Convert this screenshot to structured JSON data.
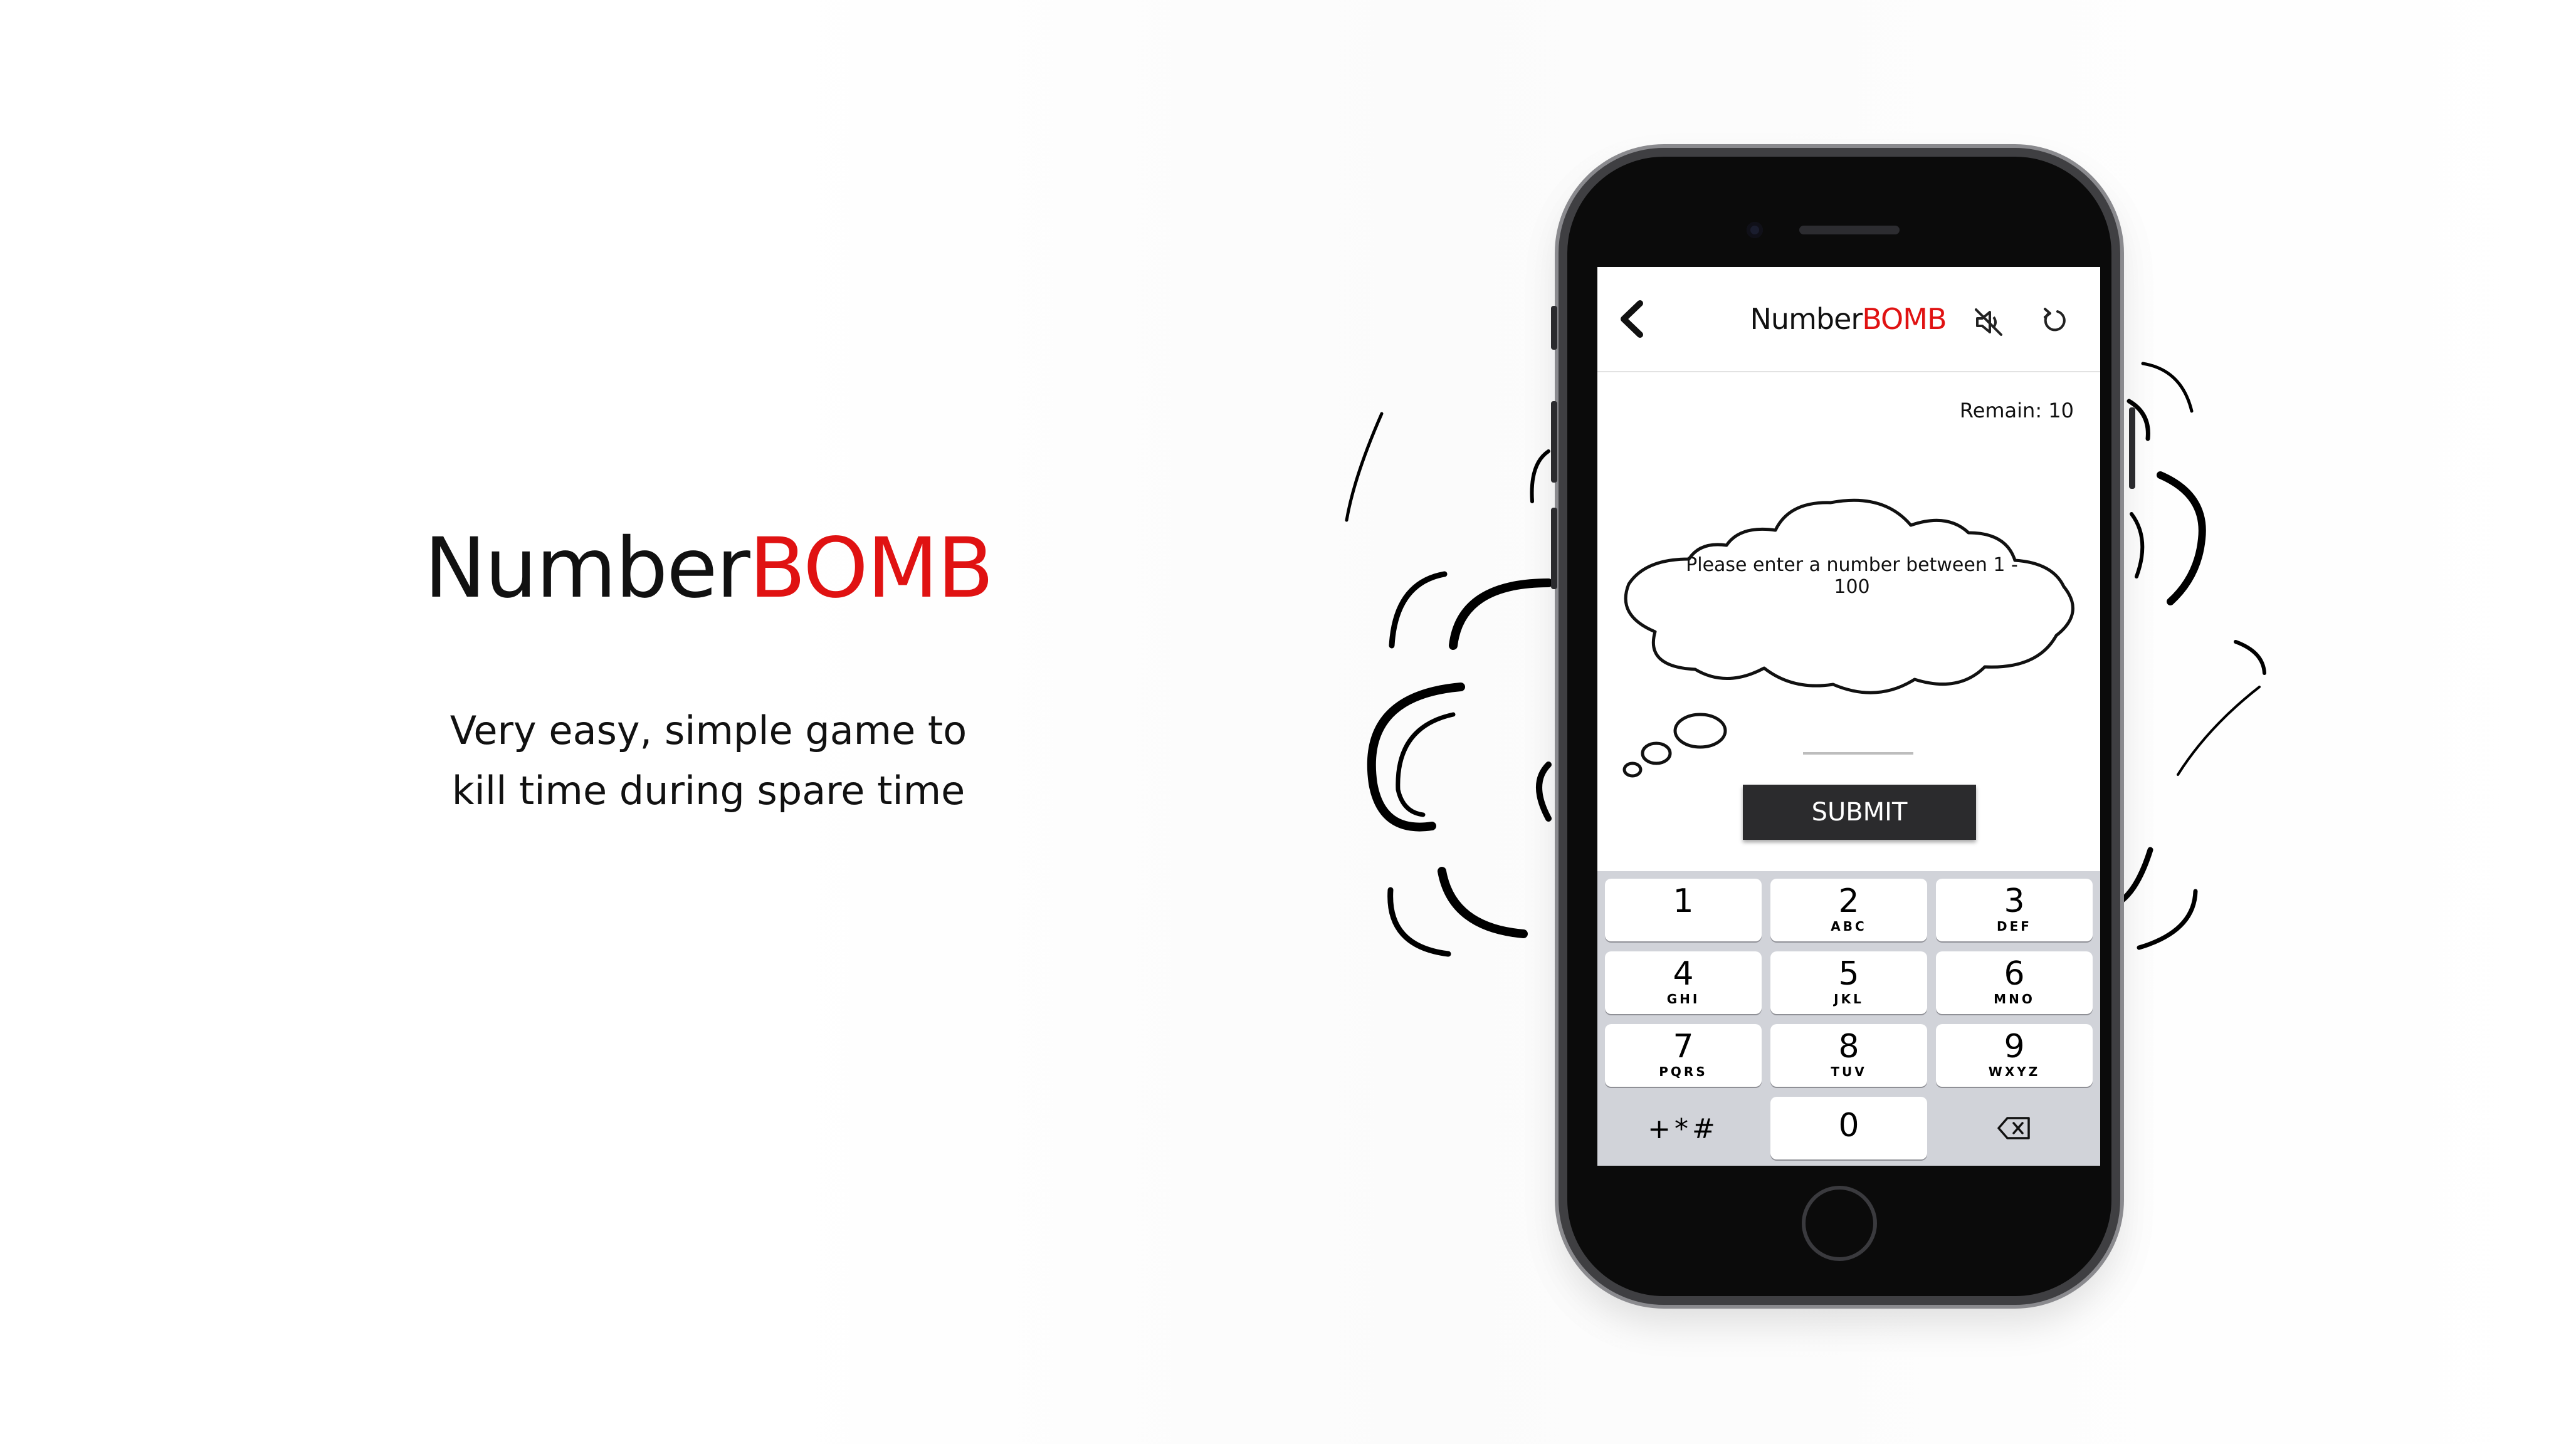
{
  "promo": {
    "title_part1": "Number",
    "title_part2": "BOMB",
    "description": [
      "Very easy, simple game to",
      "kill time during spare time"
    ]
  },
  "nav": {
    "back_icon": "chevron-left-icon",
    "title_part1": "Number",
    "title_part2": "BOMB",
    "mute_icon": "speaker-muted-icon",
    "refresh_icon": "refresh-icon"
  },
  "game": {
    "remain": "Remain: 10",
    "prompt": "Please enter a number between 1 - 100",
    "answer_value": "",
    "submit_label": "SUBMIT"
  },
  "keypad": {
    "keys": [
      {
        "num": "1",
        "letters": ""
      },
      {
        "num": "2",
        "letters": "ABC"
      },
      {
        "num": "3",
        "letters": "DEF"
      },
      {
        "num": "4",
        "letters": "GHI"
      },
      {
        "num": "5",
        "letters": "JKL"
      },
      {
        "num": "6",
        "letters": "MNO"
      },
      {
        "num": "7",
        "letters": "PQRS"
      },
      {
        "num": "8",
        "letters": "TUV"
      },
      {
        "num": "9",
        "letters": "WXYZ"
      },
      {
        "num": "+*#",
        "letters": ""
      },
      {
        "num": "0",
        "letters": ""
      },
      {
        "num": "",
        "letters": ""
      }
    ],
    "delete_icon": "backspace-icon"
  },
  "colors": {
    "accent": "#e01212",
    "submit_bg": "#2b2b2d",
    "keypad_bg": "#d1d3d9"
  }
}
